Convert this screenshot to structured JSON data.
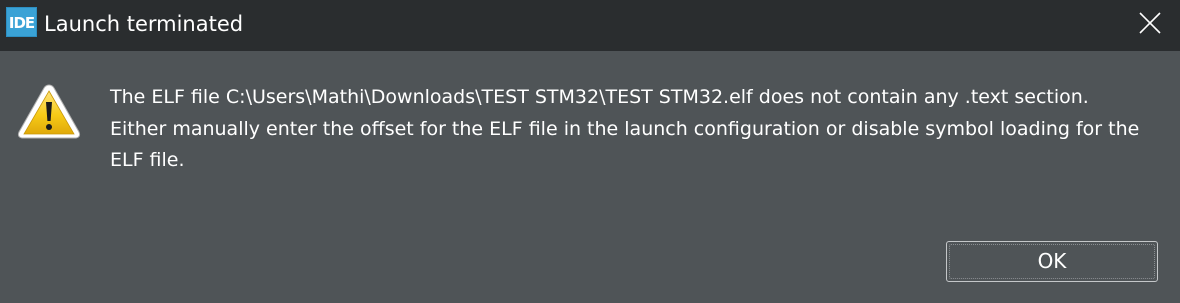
{
  "window": {
    "app_icon_text": "IDE",
    "title": "Launch terminated"
  },
  "message": {
    "text": "The ELF file C:\\Users\\Mathi\\Downloads\\TEST STM32\\TEST STM32.elf does not contain any .text section. Either manually enter the offset for the ELF file in the launch configuration or disable symbol loading for the ELF file."
  },
  "buttons": {
    "ok_label": "OK"
  },
  "icons": {
    "app": "ide-logo-icon",
    "close": "close-icon",
    "warning": "warning-icon"
  },
  "colors": {
    "titlebar": "#2a2d2f",
    "body": "#4f5457",
    "text": "#ffffff",
    "app_icon": "#3aa2d6",
    "warning_fill": "#f7cb17"
  }
}
